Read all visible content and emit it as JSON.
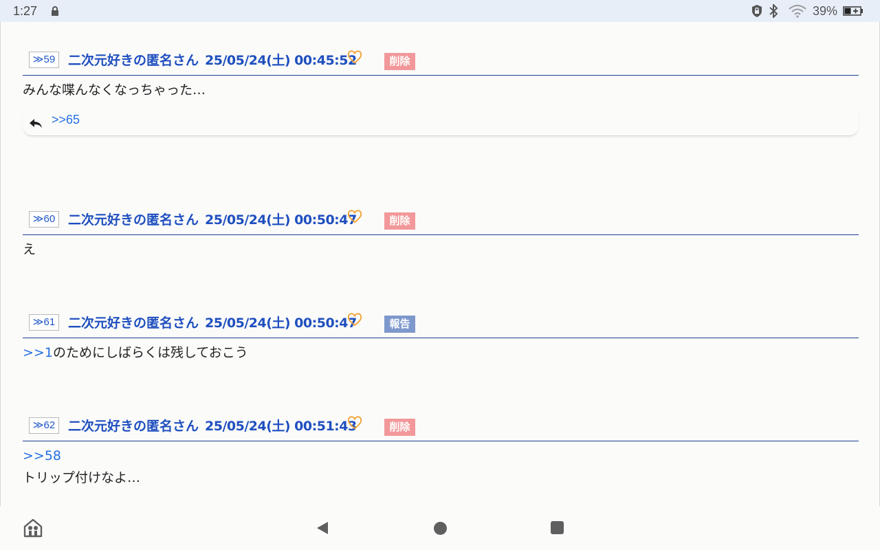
{
  "status_bar": {
    "time": "1:27",
    "battery_percent": "39%",
    "icons": [
      "lock-icon",
      "vpn-lock-icon",
      "bluetooth-icon",
      "wifi-icon",
      "battery-icon"
    ]
  },
  "posts": [
    {
      "number": "≫59",
      "author": "二次元好きの匿名さん",
      "date": "25/05/24(土) 00:45:52",
      "badge": "削除",
      "body": "みんな喋んなくなっちゃった…",
      "reply": ">>65"
    },
    {
      "number": "≫60",
      "author": "二次元好きの匿名さん",
      "date": "25/05/24(土) 00:50:47",
      "badge": "削除",
      "body": "え"
    },
    {
      "number": "≫61",
      "author": "二次元好きの匿名さん",
      "date": "25/05/24(土) 00:50:47",
      "badge": "報告",
      "body_link": ">>1",
      "body": "のためにしばらくは残しておこう"
    },
    {
      "number": "≫62",
      "author": "二次元好きの匿名さん",
      "date": "25/05/24(土) 00:51:43",
      "badge": "削除",
      "body_link": ">>58",
      "body": "トリップ付けなよ…"
    }
  ],
  "colors": {
    "accent": "#1f4fbf",
    "link": "#2470e0",
    "delete_badge": "#f2989a",
    "report_badge": "#7d98cc",
    "heart": "#f0a030"
  }
}
